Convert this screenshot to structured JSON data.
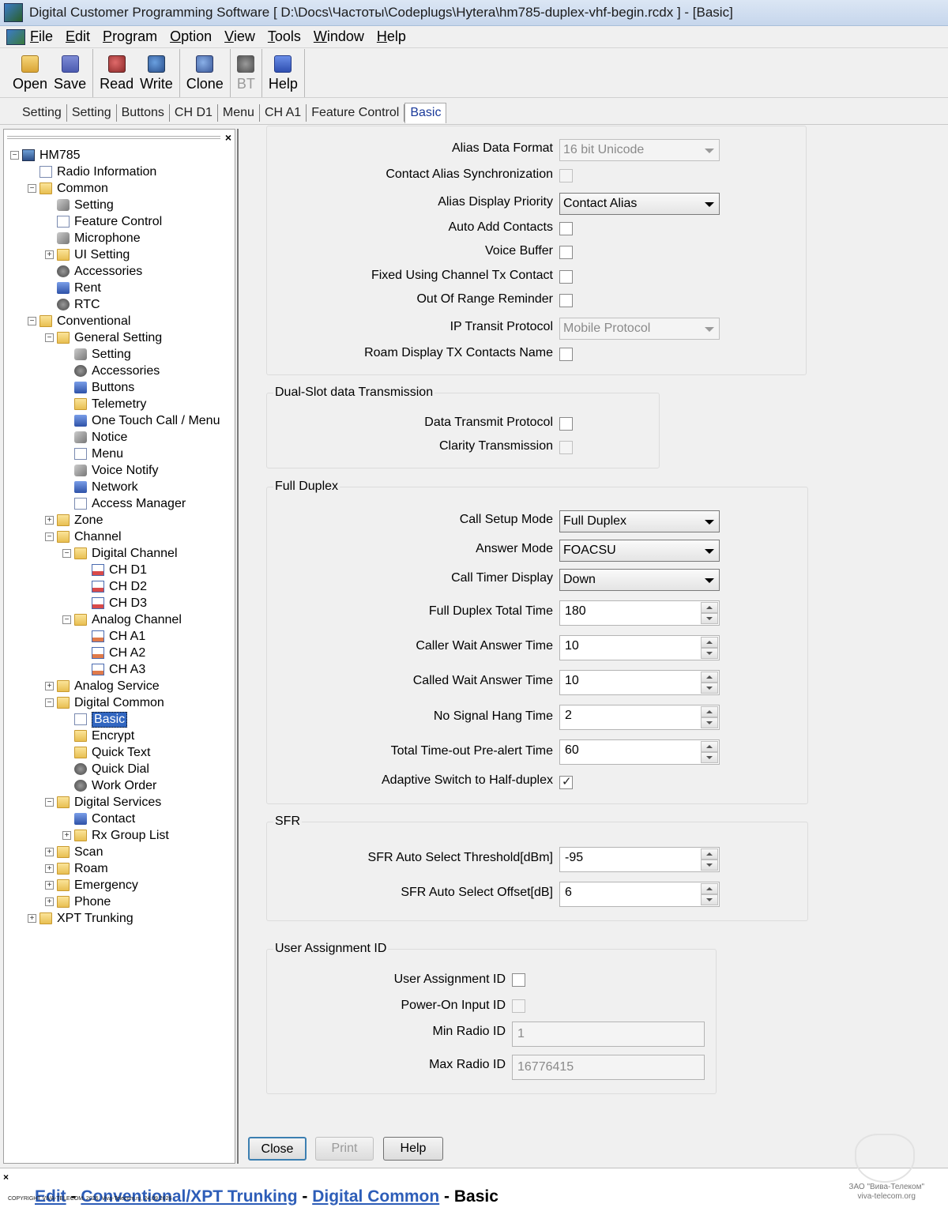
{
  "window": {
    "title": "Digital Customer Programming Software [ D:\\Docs\\Частоты\\Codeplugs\\Hytera\\hm785-duplex-vhf-begin.rcdx ] - [Basic]"
  },
  "menu": [
    "File",
    "Edit",
    "Program",
    "Option",
    "View",
    "Tools",
    "Window",
    "Help"
  ],
  "toolbar": {
    "open": "Open",
    "save": "Save",
    "read": "Read",
    "write": "Write",
    "clone": "Clone",
    "bt": "BT",
    "help": "Help"
  },
  "tabs": [
    "Setting",
    "Setting",
    "Buttons",
    "CH D1",
    "Menu",
    "CH A1",
    "Feature Control",
    "Basic"
  ],
  "tree": [
    {
      "label": "HM785",
      "level": 0,
      "exp": "-",
      "icon": "radio-icon"
    },
    {
      "label": "Radio Information",
      "level": 1,
      "exp": "",
      "icon": "document-icon"
    },
    {
      "label": "Common",
      "level": 1,
      "exp": "-",
      "icon": "folder-icon"
    },
    {
      "label": "Setting",
      "level": 2,
      "exp": "",
      "icon": "wrench-icon"
    },
    {
      "label": "Feature Control",
      "level": 2,
      "exp": "",
      "icon": "document-icon"
    },
    {
      "label": "Microphone",
      "level": 2,
      "exp": "",
      "icon": "microphone-icon"
    },
    {
      "label": "UI Setting",
      "level": 2,
      "exp": "+",
      "icon": "folder-icon"
    },
    {
      "label": "Accessories",
      "level": 2,
      "exp": "",
      "icon": "accessories-icon"
    },
    {
      "label": "Rent",
      "level": 2,
      "exp": "",
      "icon": "rent-icon"
    },
    {
      "label": "RTC",
      "level": 2,
      "exp": "",
      "icon": "clock-icon"
    },
    {
      "label": "Conventional",
      "level": 1,
      "exp": "-",
      "icon": "folder-icon"
    },
    {
      "label": "General Setting",
      "level": 2,
      "exp": "-",
      "icon": "folder-icon"
    },
    {
      "label": "Setting",
      "level": 3,
      "exp": "",
      "icon": "wrench-icon"
    },
    {
      "label": "Accessories",
      "level": 3,
      "exp": "",
      "icon": "accessories-icon"
    },
    {
      "label": "Buttons",
      "level": 3,
      "exp": "",
      "icon": "buttons-icon"
    },
    {
      "label": "Telemetry",
      "level": 3,
      "exp": "",
      "icon": "telemetry-icon"
    },
    {
      "label": "One Touch Call / Menu",
      "level": 3,
      "exp": "",
      "icon": "one-touch-call-icon"
    },
    {
      "label": "Notice",
      "level": 3,
      "exp": "",
      "icon": "notice-icon"
    },
    {
      "label": "Menu",
      "level": 3,
      "exp": "",
      "icon": "menu-icon"
    },
    {
      "label": "Voice Notify",
      "level": 3,
      "exp": "",
      "icon": "speaker-icon"
    },
    {
      "label": "Network",
      "level": 3,
      "exp": "",
      "icon": "network-icon"
    },
    {
      "label": "Access Manager",
      "level": 3,
      "exp": "",
      "icon": "access-manager-icon"
    },
    {
      "label": "Zone",
      "level": 2,
      "exp": "+",
      "icon": "folder-icon"
    },
    {
      "label": "Channel",
      "level": 2,
      "exp": "-",
      "icon": "folder-icon"
    },
    {
      "label": "Digital Channel",
      "level": 3,
      "exp": "-",
      "icon": "folder-icon"
    },
    {
      "label": "CH D1",
      "level": 4,
      "exp": "",
      "icon": "digital-channel-icon"
    },
    {
      "label": "CH D2",
      "level": 4,
      "exp": "",
      "icon": "digital-channel-icon"
    },
    {
      "label": "CH D3",
      "level": 4,
      "exp": "",
      "icon": "digital-channel-icon"
    },
    {
      "label": "Analog Channel",
      "level": 3,
      "exp": "-",
      "icon": "folder-icon"
    },
    {
      "label": "CH A1",
      "level": 4,
      "exp": "",
      "icon": "analog-channel-icon"
    },
    {
      "label": "CH A2",
      "level": 4,
      "exp": "",
      "icon": "analog-channel-icon"
    },
    {
      "label": "CH A3",
      "level": 4,
      "exp": "",
      "icon": "analog-channel-icon"
    },
    {
      "label": "Analog Service",
      "level": 2,
      "exp": "+",
      "icon": "folder-icon"
    },
    {
      "label": "Digital Common",
      "level": 2,
      "exp": "-",
      "icon": "folder-icon"
    },
    {
      "label": "Basic",
      "level": 3,
      "exp": "",
      "icon": "basic-icon",
      "selected": true
    },
    {
      "label": "Encrypt",
      "level": 3,
      "exp": "",
      "icon": "encrypt-icon"
    },
    {
      "label": "Quick Text",
      "level": 3,
      "exp": "",
      "icon": "envelope-icon"
    },
    {
      "label": "Quick Dial",
      "level": 3,
      "exp": "",
      "icon": "quick-dial-icon"
    },
    {
      "label": "Work Order",
      "level": 3,
      "exp": "",
      "icon": "work-order-icon"
    },
    {
      "label": "Digital Services",
      "level": 2,
      "exp": "-",
      "icon": "folder-icon"
    },
    {
      "label": "Contact",
      "level": 3,
      "exp": "",
      "icon": "contact-icon"
    },
    {
      "label": "Rx Group List",
      "level": 3,
      "exp": "+",
      "icon": "folder-icon"
    },
    {
      "label": "Scan",
      "level": 2,
      "exp": "+",
      "icon": "folder-icon"
    },
    {
      "label": "Roam",
      "level": 2,
      "exp": "+",
      "icon": "folder-icon"
    },
    {
      "label": "Emergency",
      "level": 2,
      "exp": "+",
      "icon": "folder-icon"
    },
    {
      "label": "Phone",
      "level": 2,
      "exp": "+",
      "icon": "folder-icon"
    },
    {
      "label": "XPT Trunking",
      "level": 1,
      "exp": "+",
      "icon": "folder-icon"
    }
  ],
  "alias": {
    "alias_data_format_label": "Alias Data Format",
    "alias_data_format_value": "16 bit Unicode",
    "contact_alias_sync_label": "Contact Alias Synchronization",
    "alias_display_priority_label": "Alias Display Priority",
    "alias_display_priority_value": "Contact Alias",
    "auto_add_contacts_label": "Auto Add Contacts",
    "voice_buffer_label": "Voice Buffer",
    "fixed_using_channel_label": "Fixed Using Channel Tx Contact",
    "out_of_range_label": "Out Of Range Reminder",
    "ip_transit_label": "IP Transit Protocol",
    "ip_transit_value": "Mobile Protocol",
    "roam_display_label": "Roam Display TX Contacts Name"
  },
  "dual_slot": {
    "title": "Dual-Slot data Transmission",
    "data_transmit_label": "Data Transmit Protocol",
    "clarity_label": "Clarity Transmission"
  },
  "full_duplex": {
    "title": "Full Duplex",
    "call_setup_label": "Call Setup Mode",
    "call_setup_value": "Full Duplex",
    "answer_mode_label": "Answer Mode",
    "answer_mode_value": "FOACSU",
    "call_timer_label": "Call Timer Display",
    "call_timer_value": "Down",
    "total_time_label": "Full Duplex Total Time",
    "total_time_value": "180",
    "caller_wait_label": "Caller Wait Answer Time",
    "caller_wait_value": "10",
    "called_wait_label": "Called Wait Answer Time",
    "called_wait_value": "10",
    "no_signal_label": "No Signal Hang Time",
    "no_signal_value": "2",
    "preaalert_label": "Total Time-out Pre-alert Time",
    "preaalert_value": "60",
    "adaptive_label": "Adaptive Switch to Half-duplex",
    "adaptive_checked": true
  },
  "sfr": {
    "title": "SFR",
    "threshold_label": "SFR Auto Select Threshold[dBm]",
    "threshold_value": "-95",
    "offset_label": "SFR Auto Select Offset[dB]",
    "offset_value": "6"
  },
  "user_assignment": {
    "title": "User Assignment ID",
    "uaid_label": "User Assignment ID",
    "power_on_label": "Power-On Input ID",
    "min_label": "Min Radio ID",
    "min_value": "1",
    "max_label": "Max Radio ID",
    "max_value": "16776415"
  },
  "buttons": {
    "close": "Close",
    "print": "Print",
    "help": "Help"
  },
  "breadcrumb": {
    "edit": "Edit",
    "sep": " - ",
    "conv": "Conventional/XPT Trunking",
    "dc": "Digital Common",
    "current": "Basic"
  },
  "footer": {
    "copyright": "COPYRIGHT VIVA-TELECOM, 2026. Viva-Telecom.ru, 24.09.2026",
    "watermark_line1": "ЗАО \"Вива-Телеком\"",
    "watermark_line2": "viva-telecom.org"
  }
}
